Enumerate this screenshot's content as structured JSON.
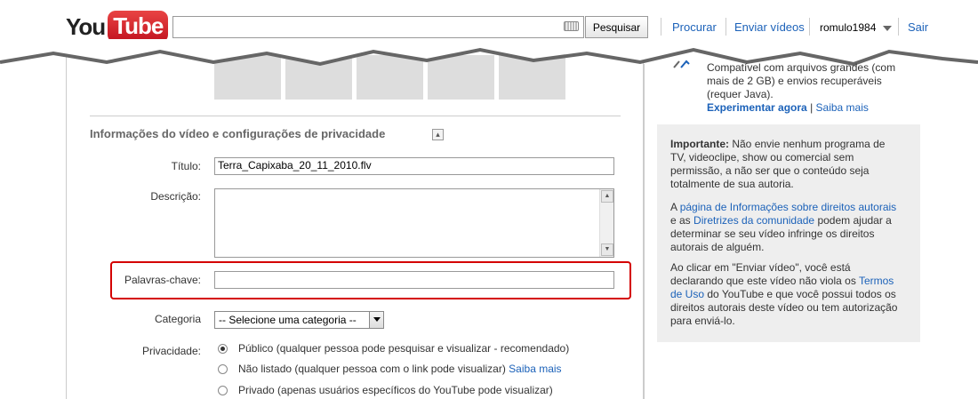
{
  "header": {
    "logo_you": "You",
    "logo_tube": "Tube",
    "search_value": "",
    "search_button": "Pesquisar",
    "nav_browse": "Procurar",
    "nav_upload": "Enviar vídeos",
    "username": "romulo1984",
    "nav_signout": "Sair"
  },
  "section": {
    "title": "Informações do vídeo e configurações de privacidade"
  },
  "form": {
    "title_label": "Título:",
    "title_value": "Terra_Capixaba_20_11_2010.flv",
    "description_label": "Descrição:",
    "description_value": "",
    "keywords_label": "Palavras-chave:",
    "keywords_value": "",
    "category_label": "Categoria",
    "category_selected": "-- Selecione uma categoria --",
    "privacy_label": "Privacidade:",
    "privacy_options": [
      {
        "label": "Público (qualquer pessoa pode pesquisar e visualizar - recomendado)",
        "selected": true
      },
      {
        "label": "Não listado (qualquer pessoa com o link pode visualizar)",
        "selected": false,
        "link": "Saiba mais"
      },
      {
        "label": "Privado (apenas usuários específicos do YouTube pode visualizar)",
        "selected": false
      }
    ]
  },
  "sidebar": {
    "uploader_lines": [
      "Compatível com arquivos grandes (com",
      "mais de 2 GB) e envios recuperáveis",
      "(requer Java)."
    ],
    "try_now": "Experimentar agora",
    "separator": "|",
    "learn_more": "Saiba mais",
    "important_bold": "Importante:",
    "important_lines": [
      "Não envie nenhum programa de",
      "TV, videoclipe, show ou comercial sem",
      "permissão, a não ser que o conteúdo seja",
      "totalmente de sua autoria."
    ],
    "p2_a": "A",
    "p2_link1": "página de Informações sobre direitos autorais",
    "p2_e": "e as",
    "p2_link2": "Diretrizes da comunidade",
    "p2_rest1": "podem ajudar a",
    "p2_rest2": "determinar se seu vídeo infringe os direitos",
    "p2_rest3": "autorais de alguém.",
    "p3_line1": "Ao clicar em \"Enviar vídeo\", você está",
    "p3_line2a": "declarando que este vídeo não viola os",
    "p3_link_a": "Termos",
    "p3_link_b": "de Uso",
    "p3_line3": "do YouTube e que você possui todos os",
    "p3_line4": "direitos autorais deste vídeo ou tem autorização",
    "p3_line5": "para enviá-lo."
  }
}
